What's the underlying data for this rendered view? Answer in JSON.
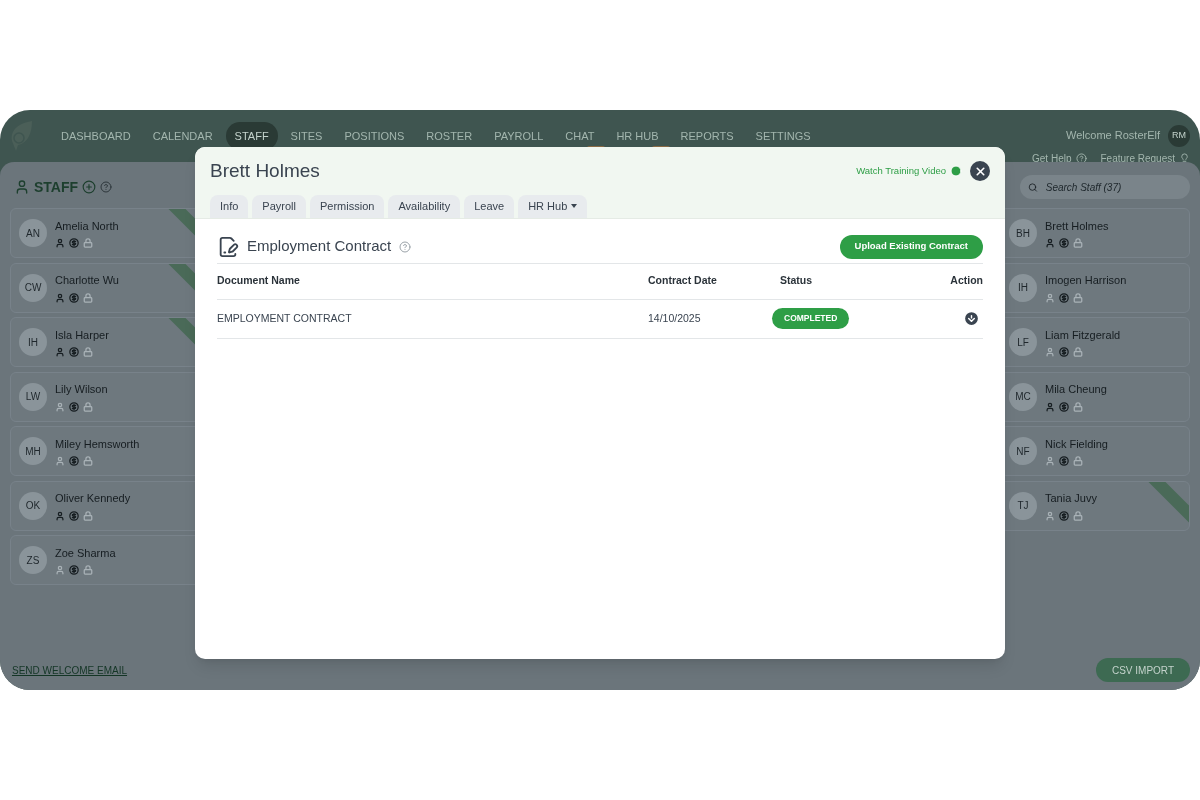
{
  "nav": {
    "items": [
      {
        "label": "DASHBOARD",
        "selected": false,
        "badge": false
      },
      {
        "label": "CALENDAR",
        "selected": false,
        "badge": false
      },
      {
        "label": "STAFF",
        "selected": true,
        "badge": false
      },
      {
        "label": "SITES",
        "selected": false,
        "badge": false
      },
      {
        "label": "POSITIONS",
        "selected": false,
        "badge": false
      },
      {
        "label": "ROSTER",
        "selected": false,
        "badge": false
      },
      {
        "label": "PAYROLL",
        "selected": false,
        "badge": false
      },
      {
        "label": "CHAT",
        "selected": false,
        "badge": true
      },
      {
        "label": "HR HUB",
        "selected": false,
        "badge": true
      },
      {
        "label": "REPORTS",
        "selected": false,
        "badge": false
      },
      {
        "label": "SETTINGS",
        "selected": false,
        "badge": false
      }
    ],
    "welcome": "Welcome RosterElf",
    "user_initials": "RM",
    "get_help": "Get Help",
    "feature_request": "Feature Request"
  },
  "staff_panel": {
    "title": "STAFF",
    "search_placeholder": "Search Staff (37)",
    "left": [
      {
        "initials": "AN",
        "name": "Amelia North",
        "profile_on": true,
        "ribbon": true
      },
      {
        "initials": "CW",
        "name": "Charlotte Wu",
        "profile_on": true,
        "ribbon": true
      },
      {
        "initials": "IH",
        "name": "Isla Harper",
        "profile_on": true,
        "ribbon": true
      },
      {
        "initials": "LW",
        "name": "Lily Wilson",
        "profile_on": false,
        "ribbon": false
      },
      {
        "initials": "MH",
        "name": "Miley Hemsworth",
        "profile_on": false,
        "ribbon": false
      },
      {
        "initials": "OK",
        "name": "Oliver Kennedy",
        "profile_on": true,
        "ribbon": false
      },
      {
        "initials": "ZS",
        "name": "Zoe Sharma",
        "profile_on": false,
        "ribbon": false
      }
    ],
    "right": [
      {
        "initials": "BH",
        "name": "Brett Holmes",
        "profile_on": true,
        "ribbon": false
      },
      {
        "initials": "IH",
        "name": "Imogen Harrison",
        "profile_on": false,
        "ribbon": false
      },
      {
        "initials": "LF",
        "name": "Liam Fitzgerald",
        "profile_on": false,
        "ribbon": false
      },
      {
        "initials": "MC",
        "name": "Mila Cheung",
        "profile_on": true,
        "ribbon": false
      },
      {
        "initials": "NF",
        "name": "Nick Fielding",
        "profile_on": false,
        "ribbon": false
      },
      {
        "initials": "TJ",
        "name": "Tania Juvy",
        "profile_on": false,
        "ribbon": true
      }
    ],
    "send_email": "SEND WELCOME EMAIL",
    "csv_import": "CSV IMPORT"
  },
  "modal": {
    "title": "Brett Holmes",
    "watch_video": "Watch Training Video",
    "tabs": [
      {
        "label": "Info",
        "selected": false,
        "dropdown": false
      },
      {
        "label": "Payroll",
        "selected": false,
        "dropdown": false
      },
      {
        "label": "Permission",
        "selected": false,
        "dropdown": false
      },
      {
        "label": "Availability",
        "selected": false,
        "dropdown": false
      },
      {
        "label": "Leave",
        "selected": false,
        "dropdown": false
      },
      {
        "label": "HR Hub",
        "selected": false,
        "dropdown": true
      }
    ],
    "section_title": "Employment Contract",
    "upload_button": "Upload Existing Contract",
    "columns": [
      "Document Name",
      "Contract Date",
      "Status",
      "Action"
    ],
    "rows": [
      {
        "document_name": "EMPLOYMENT CONTRACT",
        "contract_date": "14/10/2025",
        "status": "COMPLETED"
      }
    ]
  }
}
